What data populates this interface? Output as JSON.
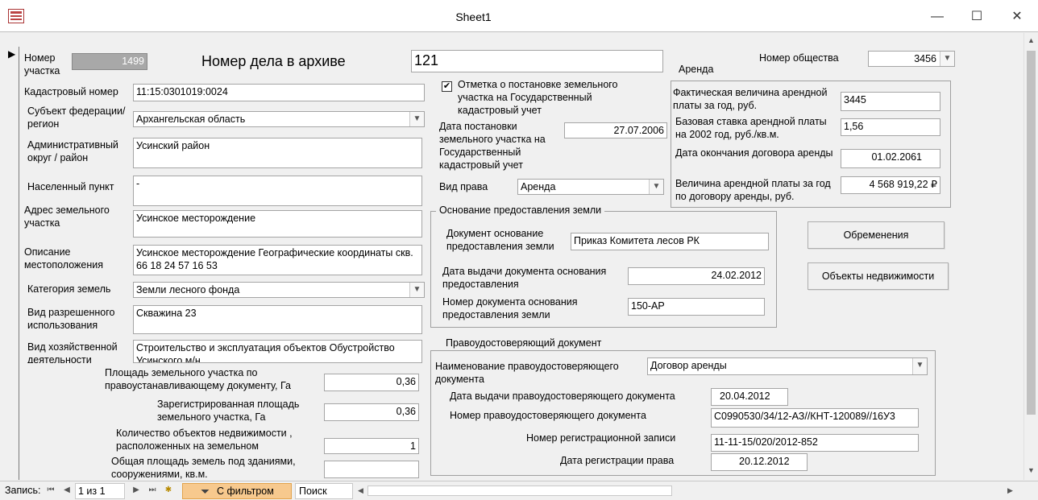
{
  "window": {
    "title": "Sheet1",
    "minimize": "—",
    "maximize": "☐",
    "close": "✕"
  },
  "record_indicator": "▶",
  "form": {
    "plot_number_label": "Номер участка",
    "plot_number_value": "1499",
    "archive_title": "Номер дела в архиве",
    "archive_value": "121",
    "society_label": "Номер общества",
    "society_value": "3456",
    "cadastral_label": "Кадастровый номер",
    "cadastral_value": "11:15:0301019:0024",
    "subject_label": "Субъект федерации/регион",
    "subject_value": "Архангельская область",
    "district_label": "Административный округ / район",
    "district_value": "Усинский район",
    "settlement_label": "Населенный пункт",
    "settlement_value": "-",
    "address_label": "Адрес земельного участка",
    "address_value": "Усинское месторождение",
    "location_label": "Описание местоположения",
    "location_value": "Усинское месторождение Географические координаты скв. 66 18 24  57 16 53",
    "category_label": "Категория земель",
    "category_value": "Земли лесного фонда",
    "permitted_use_label": "Вид разрешенного использования",
    "permitted_use_value": "Скважина 23",
    "activity_label": "Вид хозяйственной деятельности",
    "activity_value": "Строительство и эксплуатация объектов Обустройство Усинского м/н",
    "area_doc_label": "Площадь земельного участка по правоустанавливающему документу, Га",
    "area_doc_value": "0,36",
    "area_reg_label": "Зарегистрированная площадь земельного участка, Га",
    "area_reg_value": "0,36",
    "objects_count_label": "Количество объектов недвижимости , расположенных на земельном",
    "objects_count_value": "1",
    "building_area_label": "Общая площадь земель под зданиями, сооружениями, кв.м.",
    "building_area_value": "",
    "state_reg_check_label": "Отметка о постановке земельного участка на Государственный кадастровый учет",
    "state_reg_date_label": "Дата постановки земельного участка на Государственный кадастровый учет",
    "state_reg_date_value": "27.07.2006",
    "right_type_label": "Вид права",
    "right_type_value": "Аренда"
  },
  "rent": {
    "group_title": "Аренда",
    "actual_label": "Фактическая величина арендной платы за год, руб.",
    "actual_value": "3445",
    "base_rate_label": "Базовая ставка арендной платы на 2002 год, руб./кв.м.",
    "base_rate_value": "1,56",
    "end_date_label": "Дата окончания договора аренды",
    "end_date_value": "01.02.2061",
    "contract_rent_label": "Величина арендной платы за год по договору аренды, руб.",
    "contract_rent_value": "4 568 919,22 ₽"
  },
  "grounds": {
    "group_title": "Основание предоставления земли",
    "doc_label": "Документ основание предоставления земли",
    "doc_value": "Приказ Комитета лесов РК",
    "issue_date_label": "Дата выдачи документа основания предоставления",
    "issue_date_value": "24.02.2012",
    "doc_number_label": "Номер документа основания предоставления земли",
    "doc_number_value": "150-АР"
  },
  "title_doc": {
    "group_title": "Правоудостоверяющий документ",
    "name_label": "Наименование правоудостоверяющего документа",
    "name_value": "Договор аренды",
    "issue_date_label": "Дата выдачи правоудостоверяющего документа",
    "issue_date_value": "20.04.2012",
    "number_label": "Номер правоудостоверяющего документа",
    "number_value": "С0990530/34/12-АЗ//КНТ-120089//16У3",
    "reg_number_label": "Номер регистрационной записи",
    "reg_number_value": "11-11-15/020/2012-852",
    "reg_date_label": "Дата регистрации права",
    "reg_date_value": "20.12.2012"
  },
  "buttons": {
    "encumbrances": "Обременения",
    "real_estate": "Объекты недвижимости"
  },
  "navigation": {
    "record_label": "Запись:",
    "record_position": "1 из 1",
    "filter_label": "С фильтром",
    "search_placeholder": "Поиск"
  }
}
